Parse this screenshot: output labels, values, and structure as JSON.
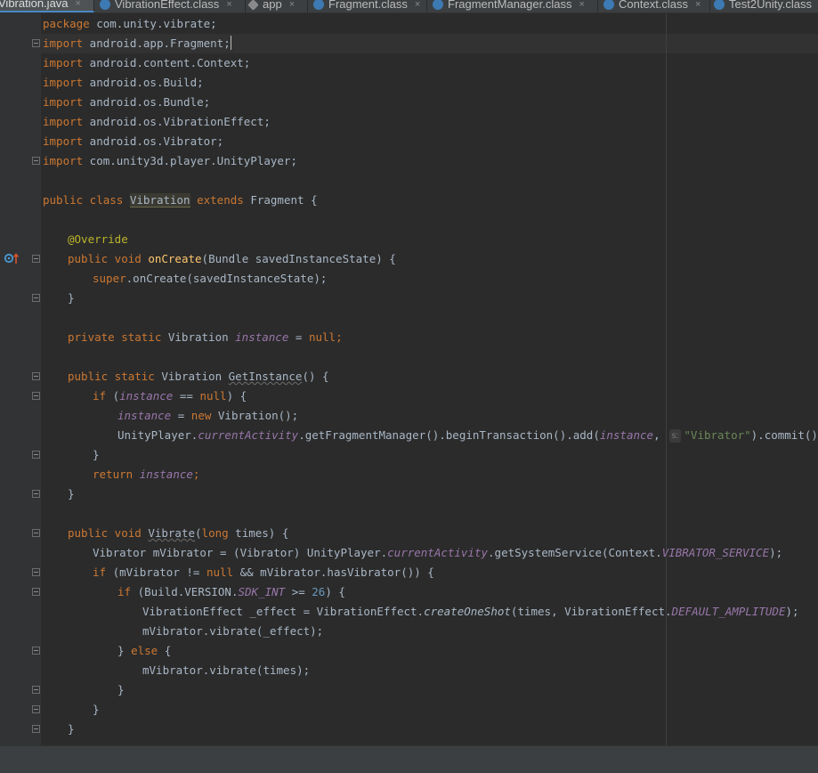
{
  "tabs": [
    {
      "label": "Vibration.java",
      "icon": "java-file-icon",
      "active": true
    },
    {
      "label": "VibrationEffect.class",
      "icon": "class-file-icon",
      "active": false
    },
    {
      "label": "app",
      "icon": "gear-icon",
      "active": false
    },
    {
      "label": "Fragment.class",
      "icon": "class-file-icon",
      "active": false
    },
    {
      "label": "FragmentManager.class",
      "icon": "class-file-icon",
      "active": false
    },
    {
      "label": "Context.class",
      "icon": "class-file-icon",
      "active": false
    },
    {
      "label": "Test2Unity.class",
      "icon": "class-file-icon",
      "active": false
    }
  ],
  "tab_close_glyph": "×",
  "code": {
    "l01": [
      "package",
      " com.unity.vibrate;"
    ],
    "l02": [
      "import",
      " android.app.Fragment;"
    ],
    "l03": [
      "import",
      " android.content.Context;"
    ],
    "l04": [
      "import",
      " android.os.Build;"
    ],
    "l05": [
      "import",
      " android.os.Bundle;"
    ],
    "l06": [
      "import",
      " android.os.VibrationEffect;"
    ],
    "l07": [
      "import",
      " android.os.Vibrator;"
    ],
    "l08": [
      "import",
      " com.unity3d.player.UnityPlayer;"
    ],
    "l10": [
      "public class",
      " ",
      "Vibration",
      " ",
      "extends",
      " Fragment {"
    ],
    "l12": [
      "@Override"
    ],
    "l13": [
      "public void",
      " ",
      "onCreate",
      "(Bundle savedInstanceState) {"
    ],
    "l14": [
      "super",
      ".onCreate(savedInstanceState);"
    ],
    "l15": [
      "}"
    ],
    "l17": [
      "private static",
      " Vibration ",
      "instance",
      " = ",
      "null",
      ";"
    ],
    "l19": [
      "public static",
      " Vibration ",
      "GetInstance",
      "() {"
    ],
    "l20": [
      "if",
      " (",
      "instance",
      " == ",
      "null",
      ") {"
    ],
    "l21": [
      "instance",
      " = ",
      "new",
      " Vibration();"
    ],
    "l22": [
      "UnityPlayer.",
      "currentActivity",
      ".getFragmentManager().beginTransaction().add(",
      "instance",
      ",",
      "s:",
      "\"Vibrator\"",
      ").commit();"
    ],
    "l23": [
      "}"
    ],
    "l24": [
      "return",
      " ",
      "instance",
      ";"
    ],
    "l25": [
      "}"
    ],
    "l27": [
      "public void",
      " ",
      "Vibrate",
      "(",
      "long",
      " times) {"
    ],
    "l28": [
      "Vibrator mVibrator = (Vibrator) UnityPlayer.",
      "currentActivity",
      ".getSystemService(Context.",
      "VIBRATOR_SERVICE",
      ");"
    ],
    "l29": [
      "if",
      " (mVibrator != ",
      "null",
      " && mVibrator.hasVibrator()) {"
    ],
    "l30": [
      "if",
      " (Build.VERSION.",
      "SDK_INT",
      " >= ",
      "26",
      ") {"
    ],
    "l31": [
      "VibrationEffect _effect = VibrationEffect.",
      "createOneShot",
      "(times, VibrationEffect.",
      "DEFAULT_AMPLITUDE",
      ");"
    ],
    "l32": [
      "mVibrator.vibrate(_effect);"
    ],
    "l33": [
      "} ",
      "else",
      " {"
    ],
    "l34": [
      "mVibrator.vibrate(times);"
    ],
    "l35": [
      "}"
    ],
    "l36": [
      "}"
    ],
    "l37": [
      "}"
    ]
  }
}
